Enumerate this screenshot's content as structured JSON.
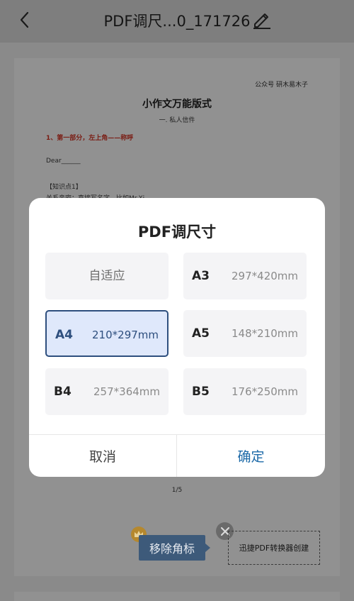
{
  "header": {
    "title": "PDF调尺...0_171726",
    "back_icon": "chevron-left-icon",
    "edit_icon": "pencil-icon"
  },
  "document": {
    "tag": "公众号 研木易木子",
    "title": "小作文万能版式",
    "subtitle": "一. 私人信件",
    "red_heading": "1、第一部分，左上角——称呼",
    "dear": "Dear______",
    "knowledge": "【知识点1】",
    "partial_line": "关系亲密：直接写名字，比如Mr.Xi",
    "page_indicator": "1/5"
  },
  "watermark": {
    "remove_label": "移除角标",
    "creator_label": "迅捷PDF转换器创建",
    "crown_icon": "crown-icon",
    "close_icon": "close-icon"
  },
  "dialog": {
    "title": "PDF调尺寸",
    "options": [
      {
        "name": "自适应",
        "size": ""
      },
      {
        "name": "A3",
        "size": "297*420mm"
      },
      {
        "name": "A4",
        "size": "210*297mm"
      },
      {
        "name": "A5",
        "size": "148*210mm"
      },
      {
        "name": "B4",
        "size": "257*364mm"
      },
      {
        "name": "B5",
        "size": "176*250mm"
      }
    ],
    "selected": "A4",
    "cancel_label": "取消",
    "confirm_label": "确定"
  },
  "colors": {
    "accent": "#2e4f7e",
    "confirm": "#1d6aa8",
    "overlay": "#8a8a8a"
  }
}
